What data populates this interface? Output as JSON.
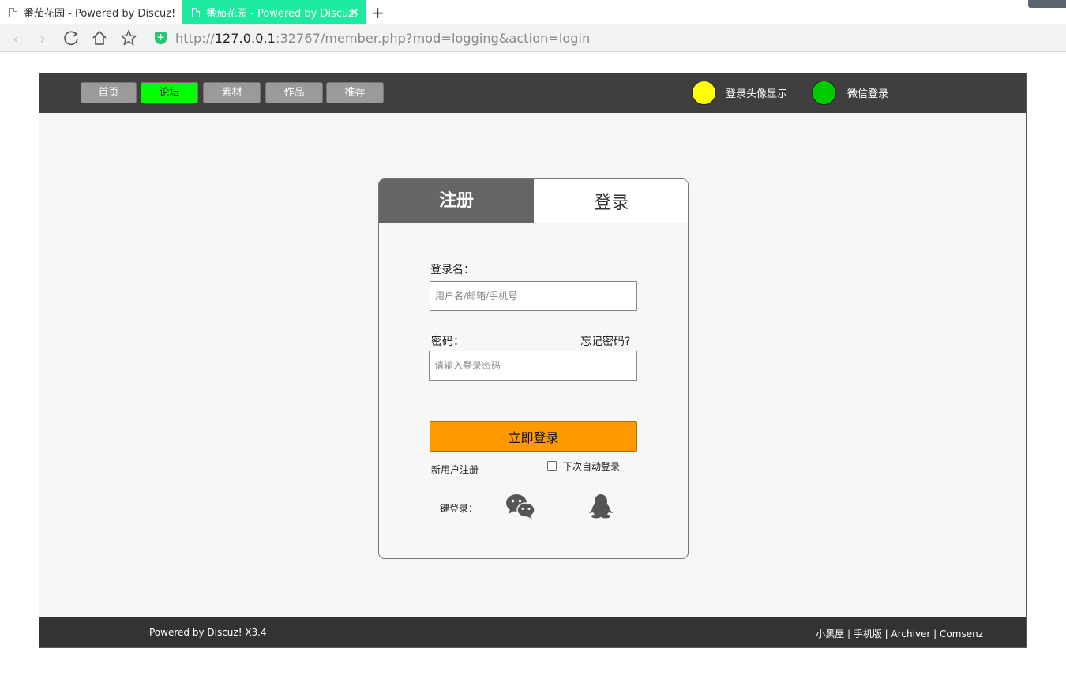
{
  "browser": {
    "tabs": [
      {
        "title": "番茄花园 - Powered by Discuz!",
        "active": false
      },
      {
        "title": "番茄花园 - Powered by Discuz!",
        "active": true
      }
    ],
    "close_glyph": "×",
    "new_tab_glyph": "+",
    "url_prefix": "http://",
    "url_host": "127.0.0.1",
    "url_rest": ":32767/member.php?mod=logging&action=login",
    "icons": [
      "back-icon",
      "forward-icon",
      "reload-icon",
      "home-icon",
      "star-icon",
      "shield-icon"
    ]
  },
  "topnav": {
    "items": [
      {
        "label": "首页",
        "active": false
      },
      {
        "label": "论坛",
        "active": true
      },
      {
        "label": "素材",
        "active": false
      },
      {
        "label": "作品",
        "active": false
      },
      {
        "label": "推荐",
        "active": false
      }
    ],
    "avatar_display": {
      "label": "登录头像显示",
      "color": "#ffff00"
    },
    "wechat_login": {
      "label": "微信登录",
      "color": "#00cc00"
    }
  },
  "card": {
    "tab_register": "注册",
    "tab_login": "登录",
    "username_label": "登录名：",
    "username_placeholder": "用户名/邮箱/手机号",
    "password_label": "密码：",
    "forgot_password": "忘记密码?",
    "password_placeholder": "请输入登录密码",
    "submit_label": "立即登录",
    "new_user_register": "新用户注册",
    "auto_login": "下次自动登录",
    "quick_login_label": "一键登录：",
    "accent_color": "#ff9900"
  },
  "footer": {
    "left": "Powered by Discuz! X3.4",
    "right": "小黑屋 | 手机版 | Archiver | Comsenz"
  }
}
